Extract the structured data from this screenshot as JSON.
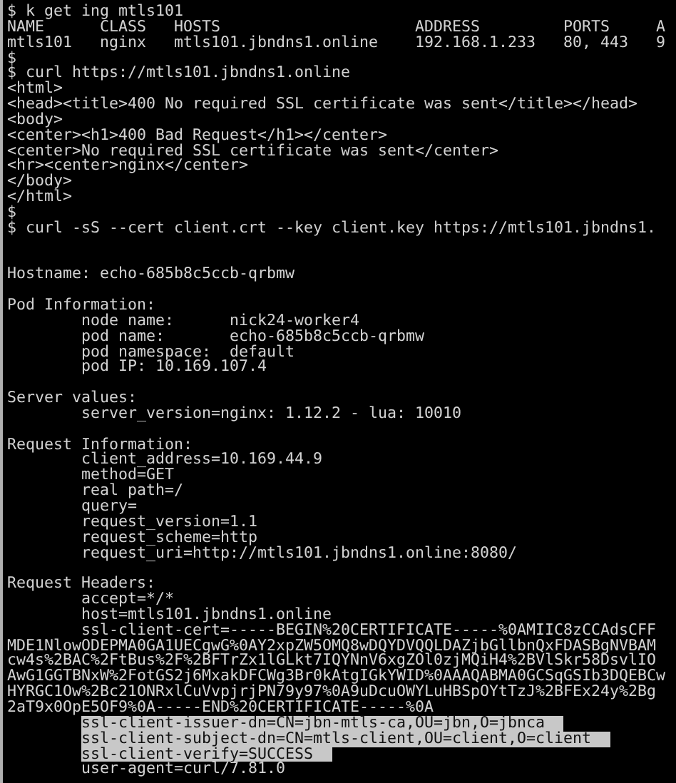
{
  "terminal": {
    "lines": [
      {
        "kind": "text",
        "text": "$ k get ing mtls101",
        "selected": false
      },
      {
        "kind": "text",
        "text": "NAME      CLASS   HOSTS                     ADDRESS         PORTS     A",
        "selected": false
      },
      {
        "kind": "text",
        "text": "mtls101   nginx   mtls101.jbndns1.online    192.168.1.233   80, 443   9",
        "selected": false
      },
      {
        "kind": "text",
        "text": "$",
        "selected": false
      },
      {
        "kind": "text",
        "text": "$ curl https://mtls101.jbndns1.online",
        "selected": false
      },
      {
        "kind": "text",
        "text": "<html>",
        "selected": false
      },
      {
        "kind": "text",
        "text": "<head><title>400 No required SSL certificate was sent</title></head>",
        "selected": false
      },
      {
        "kind": "text",
        "text": "<body>",
        "selected": false
      },
      {
        "kind": "text",
        "text": "<center><h1>400 Bad Request</h1></center>",
        "selected": false
      },
      {
        "kind": "text",
        "text": "<center>No required SSL certificate was sent</center>",
        "selected": false
      },
      {
        "kind": "text",
        "text": "<hr><center>nginx</center>",
        "selected": false
      },
      {
        "kind": "text",
        "text": "</body>",
        "selected": false
      },
      {
        "kind": "text",
        "text": "</html>",
        "selected": false
      },
      {
        "kind": "text",
        "text": "$",
        "selected": false
      },
      {
        "kind": "text",
        "text": "$ curl -sS --cert client.crt --key client.key https://mtls101.jbndns1.",
        "selected": false
      },
      {
        "kind": "blank"
      },
      {
        "kind": "blank"
      },
      {
        "kind": "text",
        "text": "Hostname: echo-685b8c5ccb-qrbmw",
        "selected": false
      },
      {
        "kind": "blank"
      },
      {
        "kind": "text",
        "text": "Pod Information:",
        "selected": false
      },
      {
        "kind": "text",
        "text": "        node name:      nick24-worker4",
        "selected": false
      },
      {
        "kind": "text",
        "text": "        pod name:       echo-685b8c5ccb-qrbmw",
        "selected": false
      },
      {
        "kind": "text",
        "text": "        pod namespace:  default",
        "selected": false
      },
      {
        "kind": "text",
        "text": "        pod IP: 10.169.107.4",
        "selected": false
      },
      {
        "kind": "blank"
      },
      {
        "kind": "text",
        "text": "Server values:",
        "selected": false
      },
      {
        "kind": "text",
        "text": "        server_version=nginx: 1.12.2 - lua: 10010",
        "selected": false
      },
      {
        "kind": "blank"
      },
      {
        "kind": "text",
        "text": "Request Information:",
        "selected": false
      },
      {
        "kind": "text",
        "text": "        client_address=10.169.44.9",
        "selected": false
      },
      {
        "kind": "text",
        "text": "        method=GET",
        "selected": false
      },
      {
        "kind": "text",
        "text": "        real path=/",
        "selected": false
      },
      {
        "kind": "text",
        "text": "        query=",
        "selected": false
      },
      {
        "kind": "text",
        "text": "        request_version=1.1",
        "selected": false
      },
      {
        "kind": "text",
        "text": "        request_scheme=http",
        "selected": false
      },
      {
        "kind": "text",
        "text": "        request_uri=http://mtls101.jbndns1.online:8080/",
        "selected": false
      },
      {
        "kind": "blank"
      },
      {
        "kind": "text",
        "text": "Request Headers:",
        "selected": false
      },
      {
        "kind": "text",
        "text": "        accept=*/*",
        "selected": false
      },
      {
        "kind": "text",
        "text": "        host=mtls101.jbndns1.online",
        "selected": false
      },
      {
        "kind": "text",
        "text": "        ssl-client-cert=-----BEGIN%20CERTIFICATE-----%0AMIIC8zCCAdsCFF",
        "selected": false
      },
      {
        "kind": "text",
        "text": "MDE1NlowODEPMA0GA1UECgwG%0AY2xpZW5OMQ8wDQYDVQQLDAZjbGllbnQxFDASBgNVBAM",
        "selected": false
      },
      {
        "kind": "text",
        "text": "cw4s%2BAC%2FtBus%2F%2BFTrZx1lGLkt7IQYNnV6xgZOl0zjMQiH4%2BVlSkr58DsvlIO",
        "selected": false
      },
      {
        "kind": "text",
        "text": "AwG1GGTBNxW%2FotGS2j6MxakDFCWg3Br0kAtgIGkYWID%0AAAQABMA0GCSqGSIb3DQEBCw",
        "selected": false
      },
      {
        "kind": "text",
        "text": "HYRGC1Ow%2Bc21ONRxlCuVvpjrjPN79y97%0A9uDcuOWYLuHBSpOYtTzJ%2BFEx24y%2Bg",
        "selected": false
      },
      {
        "kind": "text",
        "text": "2aT9x0OpE5OF9%0A-----END%20CERTIFICATE-----%0A",
        "selected": false
      },
      {
        "kind": "text",
        "text": "        ssl-client-issuer-dn=CN=jbn-mtls-ca,OU=jbn,O=jbnca",
        "selected": true
      },
      {
        "kind": "text",
        "text": "        ssl-client-subject-dn=CN=mtls-client,OU=client,O=client",
        "selected": true
      },
      {
        "kind": "text",
        "text": "        ssl-client-verify=SUCCESS",
        "selected": true
      },
      {
        "kind": "text",
        "text": "        user-agent=curl/7.81.0",
        "selected": false
      }
    ]
  }
}
